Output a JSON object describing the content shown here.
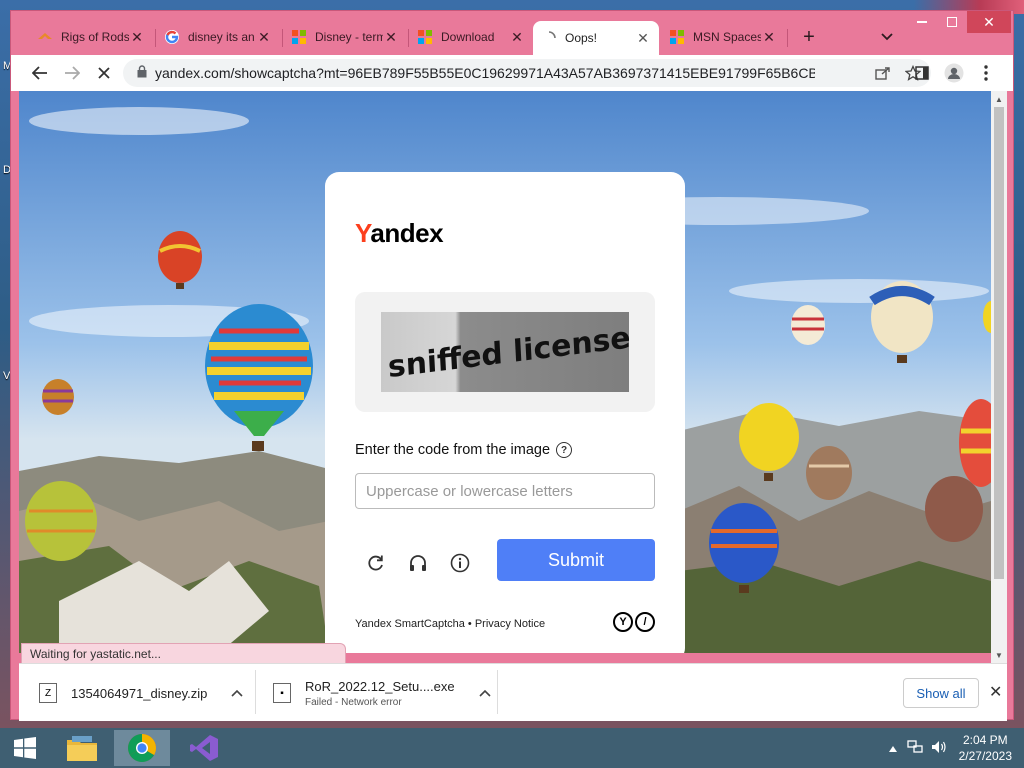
{
  "browser": {
    "tabs": [
      {
        "title": "Rigs of Rods",
        "favicon": "rigs-of-rods-icon",
        "active": false
      },
      {
        "title": "disney its an",
        "favicon": "google-icon",
        "active": false
      },
      {
        "title": "Disney - term",
        "favicon": "microsoft-icon",
        "active": false
      },
      {
        "title": "Download",
        "favicon": "microsoft-icon",
        "active": false
      },
      {
        "title": "Oops!",
        "favicon": "loading-icon",
        "active": true
      },
      {
        "title": "MSN Spaces",
        "favicon": "microsoft-icon",
        "active": false
      }
    ],
    "address": "yandex.com/showcaptcha?mt=96EB789F55B55E0C19629971A43A57AB3697371415EBE91799F65B6CBDA7..."
  },
  "captcha": {
    "logo_first": "Y",
    "logo_rest": "andex",
    "image_text": "sniffed licensee",
    "prompt": "Enter the code from the image",
    "input_placeholder": "Uppercase or lowercase letters",
    "input_value": "",
    "submit_label": "Submit",
    "footer": "Yandex SmartCaptcha • Privacy Notice"
  },
  "status_bar": "Waiting for yastatic.net...",
  "downloads": {
    "items": [
      {
        "name": "1354064971_disney.zip",
        "status": ""
      },
      {
        "name": "RoR_2022.12_Setu....exe",
        "status": "Failed - Network error"
      }
    ],
    "show_all": "Show all"
  },
  "taskbar": {
    "time": "2:04 PM",
    "date": "2/27/2023"
  },
  "desktop_edge_letters": [
    "M",
    "D",
    "V"
  ]
}
